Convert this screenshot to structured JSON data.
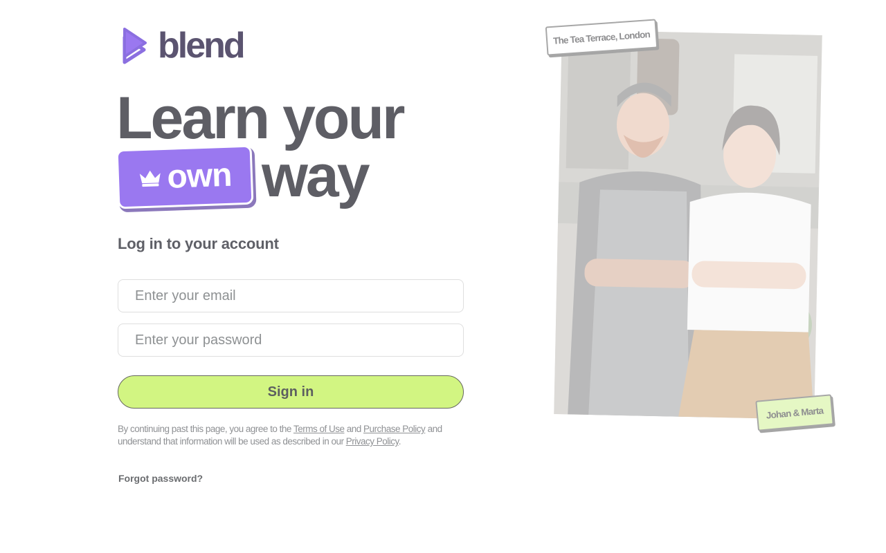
{
  "brand": {
    "name": "blend",
    "logo_icon": "blend-play-icon",
    "accent_color": "#9a78f0",
    "brand_text_color": "#5b5470"
  },
  "headline": {
    "line1": "Learn your",
    "badge_text": "own",
    "badge_icon": "crown-icon",
    "line2_end": "way"
  },
  "login": {
    "heading": "Log in to your account",
    "email": {
      "value": "",
      "placeholder": "Enter your email"
    },
    "password": {
      "value": "",
      "placeholder": "Enter your password"
    },
    "submit_label": "Sign in",
    "submit_color": "#d2f582"
  },
  "legal": {
    "prefix": "By continuing past this page, you agree to the ",
    "terms_link": "Terms of Use",
    "and": " and ",
    "purchase_link": "Purchase Policy",
    "middle": " and understand that information will be  used as described in our ",
    "privacy_link": "Privacy Policy",
    "suffix": "."
  },
  "forgot_password": "Forgot password?",
  "hero": {
    "location_tag": "The Tea Terrace, London",
    "names_tag": "Johan & Marta"
  }
}
